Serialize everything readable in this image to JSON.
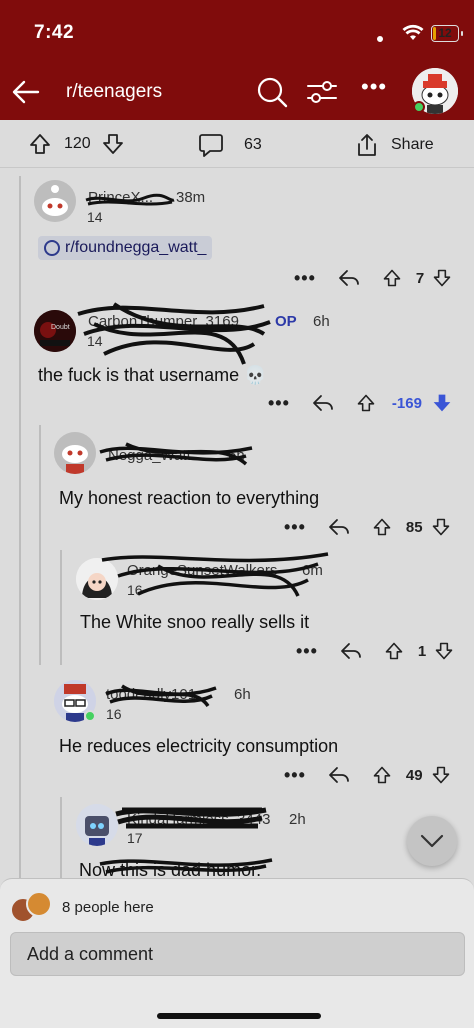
{
  "status": {
    "time": "7:42",
    "battery": "12",
    "battery_level": 0.12
  },
  "header": {
    "subreddit": "r/teenagers",
    "icons": [
      "back-arrow-icon",
      "search-icon",
      "filter-icon",
      "more-icon",
      "avatar"
    ]
  },
  "post_actions": {
    "upvotes": "120",
    "comments": "63",
    "share_label": "Share"
  },
  "comments": [
    {
      "author": "PrinceX...",
      "time": "38m",
      "karma": "14",
      "flair": "r/foundnegga_watt_",
      "votes": "7"
    },
    {
      "author": "CarbonThumper_3169",
      "op_label": "OP",
      "time": "6h",
      "karma": "14",
      "avatar_text": "Doubt",
      "body": "the fuck is that username 💀",
      "votes": "-169"
    },
    {
      "author": "Negga_Watt",
      "time": "6h",
      "body": "My honest reaction to everything",
      "votes": "85"
    },
    {
      "author": "OrangeSunsetWalkers",
      "time": "6m",
      "karma": "16",
      "body": "The White snoo really sells it",
      "votes": "1"
    },
    {
      "author": "toodeadly101",
      "time": "6h",
      "karma": "16",
      "body": "He reduces electricity consumption",
      "votes": "49"
    },
    {
      "author": "KindaHarmless_3443",
      "time": "2h",
      "karma": "17",
      "body": "Now this is dad humor."
    }
  ],
  "bottom": {
    "people_here": "8 people here",
    "add_comment_placeholder": "Add a comment"
  },
  "colors": {
    "header": "#800c0c",
    "downvote_active": "#3a55d6",
    "online": "#46d160"
  }
}
